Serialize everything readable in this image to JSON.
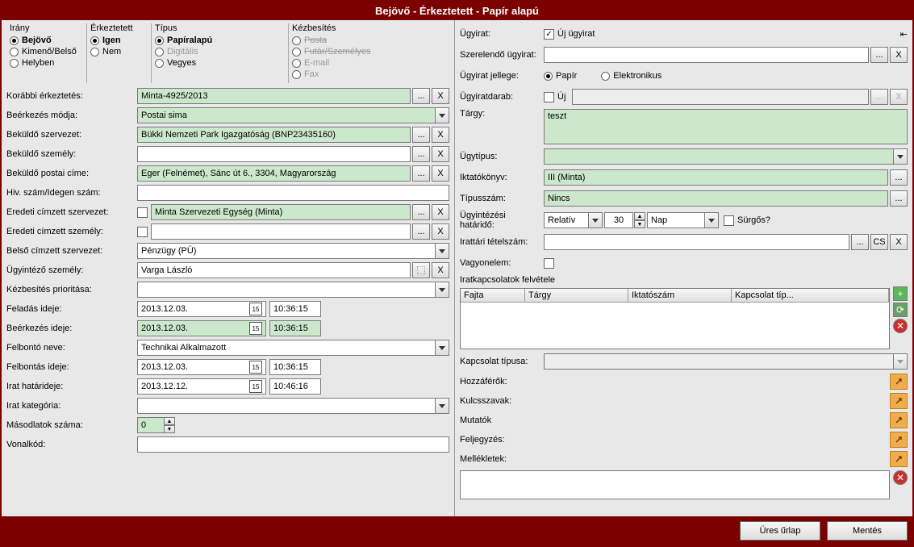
{
  "title": "Bejövő - Érkeztetett - Papír alapú",
  "groups": {
    "irany": {
      "title": "Irány",
      "opt1": "Bejövő",
      "opt2": "Kimenő/Belső",
      "opt3": "Helyben"
    },
    "erkeztetett": {
      "title": "Érkeztetett",
      "opt1": "Igen",
      "opt2": "Nem"
    },
    "tipus": {
      "title": "Típus",
      "opt1": "Papíralapú",
      "opt2": "Digitális",
      "opt3": "Vegyes"
    },
    "kezbesites": {
      "title": "Kézbesítés",
      "opt1": "Posta",
      "opt2": "Futár/Személyes",
      "opt3": "E-mail",
      "opt4": "Fax"
    }
  },
  "left": {
    "korabbi_label": "Korábbi érkeztetés:",
    "korabbi_value": "Minta-4925/2013",
    "beerkezes_modja_label": "Beérkezés módja:",
    "beerkezes_modja_value": "Postai sima",
    "bekuldo_szerv_label": "Beküldő szervezet:",
    "bekuldo_szerv_value": "Bükki Nemzeti Park Igazgatóság (BNP23435160)",
    "bekuldo_szemely_label": "Beküldő személy:",
    "bekuldo_szemely_value": "",
    "bekuldo_postai_label": "Beküldő postai címe:",
    "bekuldo_postai_value": "Eger (Felnémet), Sánc út 6., 3304, Magyarország",
    "hiv_szam_label": "Hiv. szám/Idegen szám:",
    "hiv_szam_value": "",
    "eredeti_cimzett_szerv_label": "Eredeti címzett szervezet:",
    "eredeti_cimzett_szerv_value": "Minta Szervezeti Egység (Minta)",
    "eredeti_cimzett_szemely_label": "Eredeti címzett személy:",
    "eredeti_cimzett_szemely_value": "",
    "belso_cimzett_label": "Belső címzett szervezet:",
    "belso_cimzett_value": "Pénzügy (PÜ)",
    "ugyintezo_label": "Ügyintéző személy:",
    "ugyintezo_value": "Varga László",
    "kezbesites_prioritas_label": "Kézbesítés prioritása:",
    "feladas_ideje_label": "Feladás ideje:",
    "feladas_date": "2013.12.03.",
    "feladas_time": "10:36:15",
    "beerkezes_ideje_label": "Beérkezés ideje:",
    "beerkezes_date": "2013.12.03.",
    "beerkezes_time": "10:36:15",
    "felbonto_neve_label": "Felbontó neve:",
    "felbonto_neve_value": "Technikai Alkalmazott",
    "felbontas_ideje_label": "Felbontás ideje:",
    "felbontas_date": "2013.12.03.",
    "felbontas_time": "10:36:15",
    "irat_hatarideje_label": "Irat határideje:",
    "irat_hatar_date": "2013.12.12.",
    "irat_hatar_time": "10:46:16",
    "irat_kategoria_label": "Irat kategória:",
    "masodlatok_label": "Másodlatok száma:",
    "masodlatok_value": "0",
    "vonalkod_label": "Vonalkód:"
  },
  "right": {
    "ugyirat_label": "Ügyirat:",
    "uj_ugyirat": "Új ügyirat",
    "szerelendo_label": "Szerelendő ügyirat:",
    "ugyirat_jellege_label": "Ügyirat jellege:",
    "papir": "Papír",
    "elektronikus": "Elektronikus",
    "ugyiratdarab_label": "Ügyiratdarab:",
    "uj": "Új",
    "targy_label": "Tárgy:",
    "targy_value": "teszt",
    "ugytipus_label": "Ügytípus:",
    "iktatokonyv_label": "Iktatókönyv:",
    "iktatokonyv_value": "III (Minta)",
    "tipusszam_label": "Típusszám:",
    "tipusszam_value": "Nincs",
    "ugyintezesi_label": "Ügyintézési határidő:",
    "relativ": "Relatív",
    "nap": "Nap",
    "harminc": "30",
    "surgos": "Sürgős?",
    "irattari_label": "Irattári tételszám:",
    "cs": "CS",
    "vagyonelem_label": "Vagyonelem:",
    "iratkapcs_label": "Iratkapcsolatok felvétele",
    "th1": "Fajta",
    "th2": "Tárgy",
    "th3": "Iktatószám",
    "th4": "Kapcsolat típ...",
    "kapcsolat_tipusa_label": "Kapcsolat típusa:",
    "hozzaferok": "Hozzáférők:",
    "kulcsszavak": "Kulcsszavak:",
    "mutatok": "Mutatók",
    "feljegyzes": "Feljegyzés:",
    "mellekletek": "Mellékletek:"
  },
  "buttons": {
    "ellipsis": "...",
    "x": "X",
    "ures_urlap": "Üres űrlap",
    "mentes": "Mentés"
  }
}
